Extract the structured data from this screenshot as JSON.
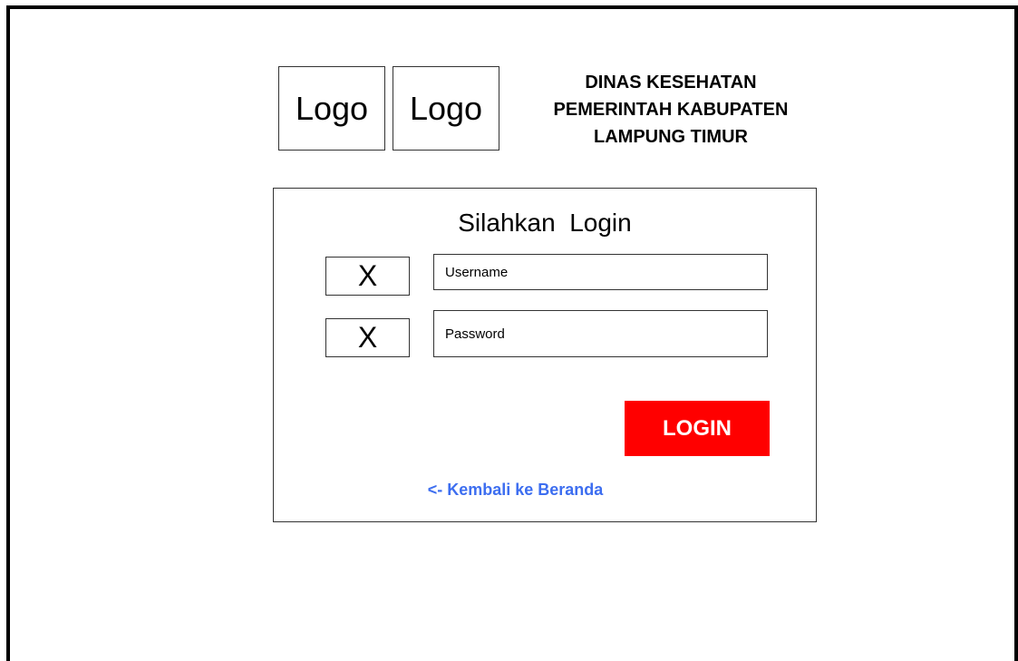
{
  "logos": [
    {
      "label": "Logo"
    },
    {
      "label": "Logo"
    }
  ],
  "header": {
    "line1": "DINAS KESEHATAN",
    "line2": "PEMERINTAH KABUPATEN",
    "line3": "LAMPUNG TIMUR"
  },
  "login": {
    "heading": "Silahkan  Login",
    "username": {
      "icon": "X",
      "placeholder": "Username"
    },
    "password": {
      "icon": "X",
      "placeholder": "Password"
    },
    "button_label": "LOGIN",
    "button_color": "#ff0000",
    "back_link": "<- Kembali ke Beranda",
    "link_color": "#3d6ef0"
  }
}
